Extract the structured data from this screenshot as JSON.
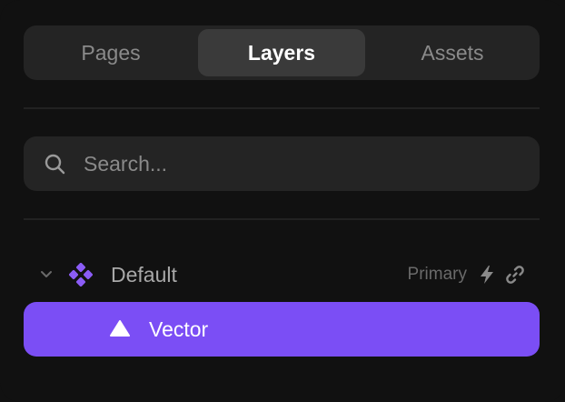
{
  "tabs": [
    {
      "label": "Pages",
      "active": false
    },
    {
      "label": "Layers",
      "active": true
    },
    {
      "label": "Assets",
      "active": false
    }
  ],
  "search": {
    "placeholder": "Search...",
    "value": "",
    "icon": "search-icon"
  },
  "layers": {
    "component": {
      "label": "Default",
      "variant_label": "Primary",
      "expanded": true,
      "icon": "component-icon",
      "actions": [
        "bolt-icon",
        "link-icon"
      ]
    },
    "children": [
      {
        "label": "Vector",
        "icon": "vector-triangle-icon",
        "selected": true
      }
    ]
  },
  "colors": {
    "background": "#111111",
    "surface": "#242424",
    "active_tab": "#3a3a3a",
    "accent": "#7b4ef5",
    "component_icon": "#8b5cf6"
  }
}
